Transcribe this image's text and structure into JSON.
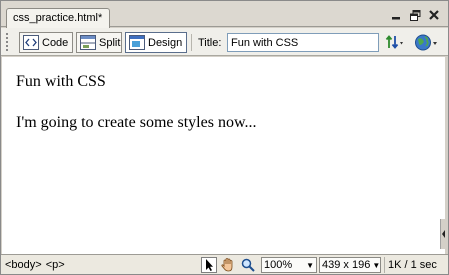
{
  "document_tab": {
    "label": "css_practice.html*"
  },
  "window_controls": [
    "minimize-icon",
    "restore-icon",
    "close-icon"
  ],
  "toolbar": {
    "code_label": "Code",
    "split_label": "Split",
    "design_label": "Design",
    "active_view": "Design",
    "title_label": "Title:",
    "title_value": "Fun with CSS",
    "refresh_icon": "refresh-arrows-icon",
    "preview_icon": "globe-preview-icon"
  },
  "design_view": {
    "paragraphs": [
      "Fun with CSS",
      "I'm going to create some styles now..."
    ]
  },
  "status_bar": {
    "tag_selector": [
      "<body>",
      "<p>"
    ],
    "zoom": "100%",
    "window_size": "439 x 196",
    "file_info": "1K / 1 sec"
  },
  "colors": {
    "chrome": "#d4d0c8",
    "toolbar": "#f0efea",
    "active_border": "#5a6e8c",
    "input_border": "#7f9db9"
  }
}
